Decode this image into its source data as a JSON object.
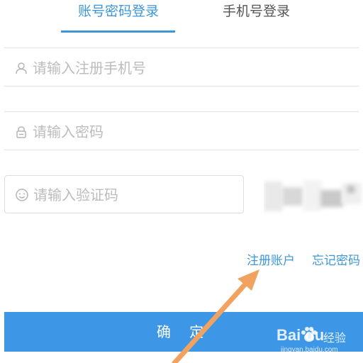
{
  "tabs": {
    "account_login": "账号密码登录",
    "phone_login": "手机号登录",
    "active": "account_login"
  },
  "fields": {
    "phone": {
      "placeholder": "请输入注册手机号",
      "value": ""
    },
    "password": {
      "placeholder": "请输入密码",
      "value": ""
    },
    "captcha": {
      "placeholder": "请输入验证码",
      "value": ""
    }
  },
  "links": {
    "register": "注册账户",
    "forgot_password": "忘记密码"
  },
  "confirm_button": "确 定",
  "watermark": {
    "logo": "Bai du",
    "suffix": "经验",
    "url": "jingyan.baidu.com"
  },
  "colors": {
    "accent": "#3d97d6",
    "button": "#3d97e6",
    "annotation_arrow": "#f0a25e",
    "placeholder": "#bcbcbc",
    "divider": "#e2e2e2"
  },
  "icons": {
    "phone": "user-icon",
    "password": "lock-icon",
    "captcha": "smile-icon"
  }
}
